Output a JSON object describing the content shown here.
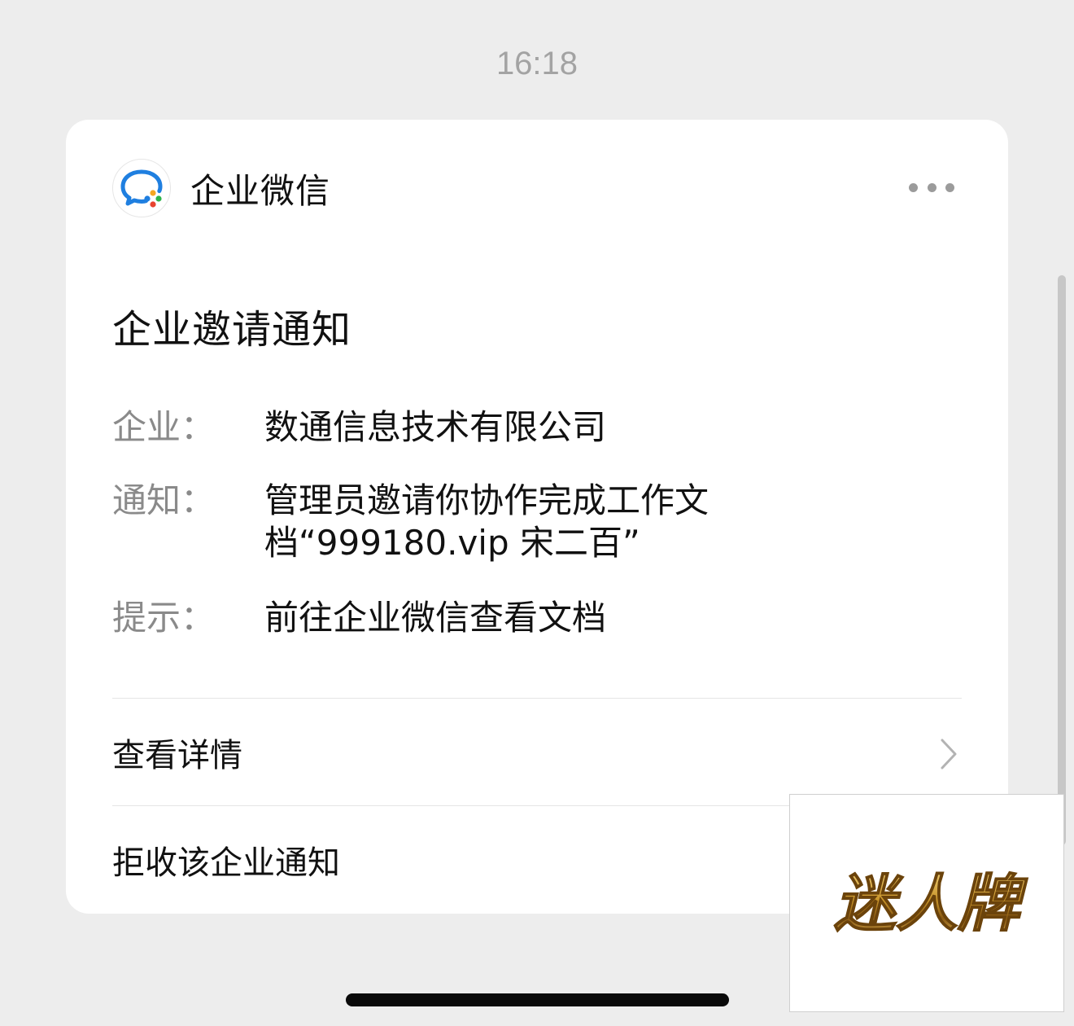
{
  "status": {
    "time": "16:18"
  },
  "card": {
    "app_name": "企业微信",
    "title": "企业邀请通知",
    "fields": [
      {
        "label": "企业：",
        "value": "数通信息技术有限公司"
      },
      {
        "label": "通知：",
        "value": "管理员邀请你协作完成工作文档“999180.vip 宋二百”"
      },
      {
        "label": "提示：",
        "value": "前往企业微信查看文档"
      }
    ],
    "actions": {
      "details": "查看详情",
      "reject": "拒收该企业通知"
    }
  },
  "watermark": {
    "text": "迷人牌"
  },
  "colors": {
    "background": "#ededed",
    "card": "#ffffff",
    "label_gray": "#8a8a8a",
    "text": "#111111",
    "watermark_gold": "#c9952b"
  },
  "icons": [
    "wecom-logo-icon",
    "more-icon",
    "chevron-right-icon"
  ]
}
